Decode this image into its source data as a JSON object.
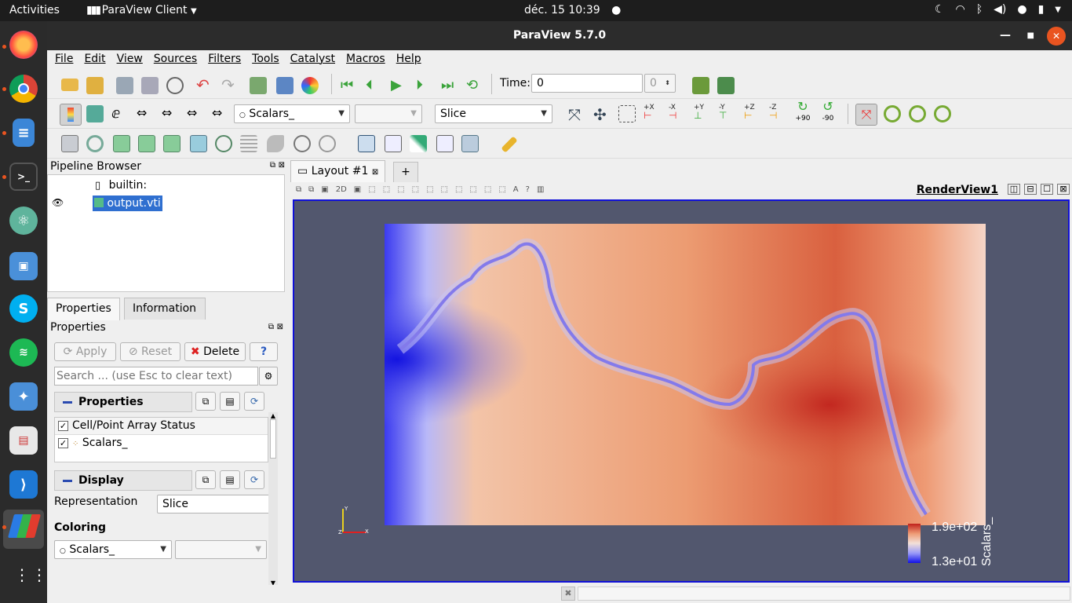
{
  "topbar": {
    "activities": "Activities",
    "app_menu": "ParaView Client",
    "clock": "déc. 15  10:39"
  },
  "window": {
    "title": "ParaView 5.7.0"
  },
  "menus": [
    "File",
    "Edit",
    "View",
    "Sources",
    "Filters",
    "Tools",
    "Catalyst",
    "Macros",
    "Help"
  ],
  "time": {
    "label": "Time:",
    "value": "0",
    "step": "0"
  },
  "toolbar2": {
    "array_combo": "Scalars_",
    "component_combo": "",
    "representation_combo": "Slice",
    "camera_labels": [
      "+X",
      "-X",
      "+Y",
      "-Y",
      "+Z",
      "-Z",
      "+90",
      "-90"
    ]
  },
  "pipeline": {
    "title": "Pipeline Browser",
    "root": "builtin:",
    "item": "output.vti"
  },
  "tabs": {
    "properties": "Properties",
    "information": "Information"
  },
  "properties": {
    "title": "Properties",
    "apply": "Apply",
    "reset": "Reset",
    "delete": "Delete",
    "help": "?",
    "search_placeholder": "Search ... (use Esc to clear text)",
    "section_properties": "Properties (output",
    "array_status_header": "Cell/Point Array Status",
    "array_item": "Scalars_",
    "section_display": "Display (UniformGı",
    "representation_label": "Representation",
    "representation_value": "Slice",
    "coloring_label": "Coloring",
    "coloring_value": "Scalars_"
  },
  "layout": {
    "tab": "Layout #1",
    "add": "+",
    "view_name": "RenderView1",
    "mode_2d": "2D"
  },
  "colorbar": {
    "max": "1.9e+02",
    "min": "1.3e+01",
    "title": "Scalars_"
  },
  "axes": {
    "y": "Y",
    "z": "Z",
    "x": "X"
  },
  "colors": {
    "background": "#52576e",
    "selection": "#2f6fd0",
    "accent_blue": "#1010d8"
  }
}
